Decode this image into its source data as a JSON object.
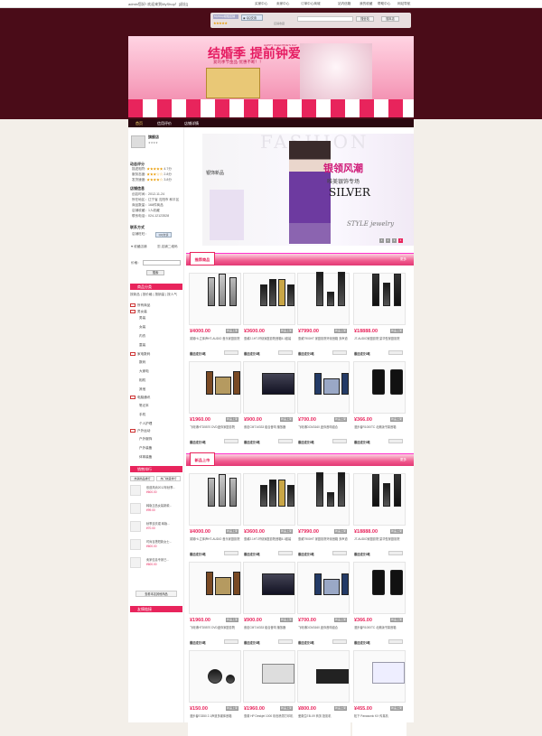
{
  "topbar": {
    "welcome": "admin您好! 欢迎来到MyShop！[退出]",
    "nav": [
      "买家中心",
      "卖家中心",
      "订单中心商城",
      "站内信箱",
      "我的收藏",
      "帮助中心",
      "网站导航"
    ]
  },
  "shop_search": {
    "shop_name": "MyShop模板店铺",
    "qq_label": "QQ交谈",
    "input_placeholder": "",
    "search_all": "搜全站",
    "search_shop": "搜本店",
    "note": "店铺收藏"
  },
  "banner": {
    "title": "结婚季 提前钟爱",
    "badge": "HAPPY VALENTINE'S DAY",
    "subtitle": "爱的季节金品·优惠不断！！"
  },
  "main_nav": [
    "首页",
    "信用评价",
    "店铺详情"
  ],
  "sidebar": {
    "shop_title": "旗舰店",
    "rating_title": "动态评分",
    "ratings": [
      {
        "label": "描述相符:",
        "score": "4.7分"
      },
      {
        "label": "服务态度:",
        "score": "2.8分"
      },
      {
        "label": "发货速度:",
        "score": "3.8分"
      }
    ],
    "info_title": "店铺信息",
    "info": [
      "创店时间：2012-11-24",
      "所在地区：辽宁省 沈阳市 和平区",
      "商品数量：168件商品",
      "店铺收藏：1人收藏",
      "联系电话：024-12123528"
    ],
    "contact_title": "联系方式",
    "contact_label": "店铺旺旺：",
    "contact_qq": "QQ交谈",
    "fav_label": "收藏店铺",
    "qr_label": "店铺二维码",
    "price_label": "价格：",
    "search_btn": "搜索",
    "cat_header": "商品分类",
    "sort_tabs": [
      "按新品",
      "按价格",
      "按销量",
      "按人气"
    ],
    "categories": [
      "所有商品",
      "男女装",
      "男装",
      "女装",
      "内衣",
      "童装",
      "家电数码",
      "数码",
      "大家电",
      "相机",
      "其他",
      "电脑通讯",
      "笔记本",
      "手机",
      "个人护理",
      "户外运动",
      "户外服饰",
      "户外装备",
      "体育装备"
    ],
    "rank_header": "销售排行",
    "rank_tabs": [
      "热销商品排行",
      "热门收藏排行"
    ],
    "rank_items": [
      {
        "name": "依道风尚2012年秋季...",
        "price": "¥600.00"
      },
      {
        "name": "韩版正品女装新款...",
        "price": "¥99.00"
      },
      {
        "name": "秋季连衣裙 韩版...",
        "price": "¥70.00"
      },
      {
        "name": "时尚百搭短款女士...",
        "price": "¥600.00"
      },
      {
        "name": "卖家信息专家已...",
        "price": "¥600.00"
      }
    ],
    "rank_more": "查看本店其他商品",
    "friend_header": "友情链接"
  },
  "hero": {
    "bg_text": "FASHION",
    "title": "银领风潮",
    "subtitle": "唯美银饰专场",
    "big": "SILVER",
    "style": "STYLE jewelry",
    "left_caption": "银饰新品",
    "pager": [
      "1",
      "2",
      "3",
      "4"
    ]
  },
  "sections": [
    {
      "title": "推荐商品",
      "more": "更多",
      "products": [
        {
          "price": "¥4000.00",
          "name": "英雄HI-立体声HT-AUDIO 音乐家庭影院",
          "sold": "最近成交0笔",
          "tag": "新品上架",
          "img": "hometheater-silver"
        },
        {
          "price": "¥3600.00",
          "name": "惠威2.1HT-环绕家庭影院音箱5.1套装",
          "sold": "最近成交0笔",
          "tag": "新品上架",
          "img": "hometheater-black"
        },
        {
          "price": "¥7990.00",
          "name": "惠威T900HT 家庭影院环绕音箱 多声道",
          "sold": "最近成交0笔",
          "tag": "新品上架",
          "img": "speakers-tall"
        },
        {
          "price": "¥18888.00",
          "name": "JT-AUDIO家庭影院 豪华型家庭影院",
          "sold": "最近成交0笔",
          "tag": "新品上架",
          "img": "hometheater-wood"
        },
        {
          "price": "¥1960.00",
          "name": "飞利浦HTD5570 DVD迷你家庭影院",
          "sold": "最近成交0笔",
          "tag": "新品上架",
          "img": "minisystem-wood"
        },
        {
          "price": "¥900.00",
          "name": "索尼CMT-M333 组合音响 播放器",
          "sold": "最近成交0笔",
          "tag": "新品上架",
          "img": "minisystem-dark"
        },
        {
          "price": "¥700.00",
          "name": "飞利浦DCM3160 迷你音响组合",
          "sold": "最近成交0笔",
          "tag": "新品上架",
          "img": "minisystem-blue"
        },
        {
          "price": "¥366.00",
          "name": "漫步者R1000TC 北美版书架音箱",
          "sold": "最近成交0笔",
          "tag": "新品上架",
          "img": "bookshelf-speakers"
        }
      ]
    },
    {
      "title": "新品上市",
      "more": "更多",
      "products": [
        {
          "price": "¥4000.00",
          "name": "英雄HI-立体声HT-AUDIO 音乐家庭影院",
          "sold": "最近成交0笔",
          "tag": "新品上架",
          "img": "hometheater-silver"
        },
        {
          "price": "¥3600.00",
          "name": "惠威2.1HT-环绕家庭影院音箱5.1套装",
          "sold": "最近成交0笔",
          "tag": "新品上架",
          "img": "hometheater-black"
        },
        {
          "price": "¥7990.00",
          "name": "惠威T900HT 家庭影院环绕音箱 多声道",
          "sold": "最近成交0笔",
          "tag": "新品上架",
          "img": "speakers-tall"
        },
        {
          "price": "¥18888.00",
          "name": "JT-AUDIO家庭影院 豪华型家庭影院",
          "sold": "最近成交0笔",
          "tag": "新品上架",
          "img": "hometheater-wood"
        },
        {
          "price": "¥1960.00",
          "name": "飞利浦HTD5570 DVD迷你家庭影院",
          "sold": "最近成交0笔",
          "tag": "新品上架",
          "img": "minisystem-wood"
        },
        {
          "price": "¥900.00",
          "name": "索尼CMT-M333 组合音响 播放器",
          "sold": "最近成交0笔",
          "tag": "新品上架",
          "img": "minisystem-dark"
        },
        {
          "price": "¥700.00",
          "name": "飞利浦DCM3160 迷你音响组合",
          "sold": "最近成交0笔",
          "tag": "新品上架",
          "img": "minisystem-blue"
        },
        {
          "price": "¥366.00",
          "name": "漫步者R1000TC 北美版书架音箱",
          "sold": "最近成交0笔",
          "tag": "新品上架",
          "img": "bookshelf-speakers"
        },
        {
          "price": "¥150.00",
          "name": "漫步者E3350 2.1声道多媒体音箱",
          "sold": "",
          "tag": "新品上架",
          "img": "pc-speakers"
        },
        {
          "price": "¥1960.00",
          "name": "惠普 HP Deskjet 1000 彩色喷墨打印机",
          "sold": "",
          "tag": "新品上架",
          "img": "printer"
        },
        {
          "price": "¥800.00",
          "name": "爱普生EB-X9 商务 投影机",
          "sold": "",
          "tag": "新品上架",
          "img": "projector"
        },
        {
          "price": "¥455.00",
          "name": "松下 Panasonic KX 传真机",
          "sold": "",
          "tag": "新品上架",
          "img": "fax"
        }
      ]
    }
  ],
  "colors": {
    "accent": "#e8245c",
    "header_bg": "#4a0c18",
    "nav_bg": "#2a0910"
  }
}
